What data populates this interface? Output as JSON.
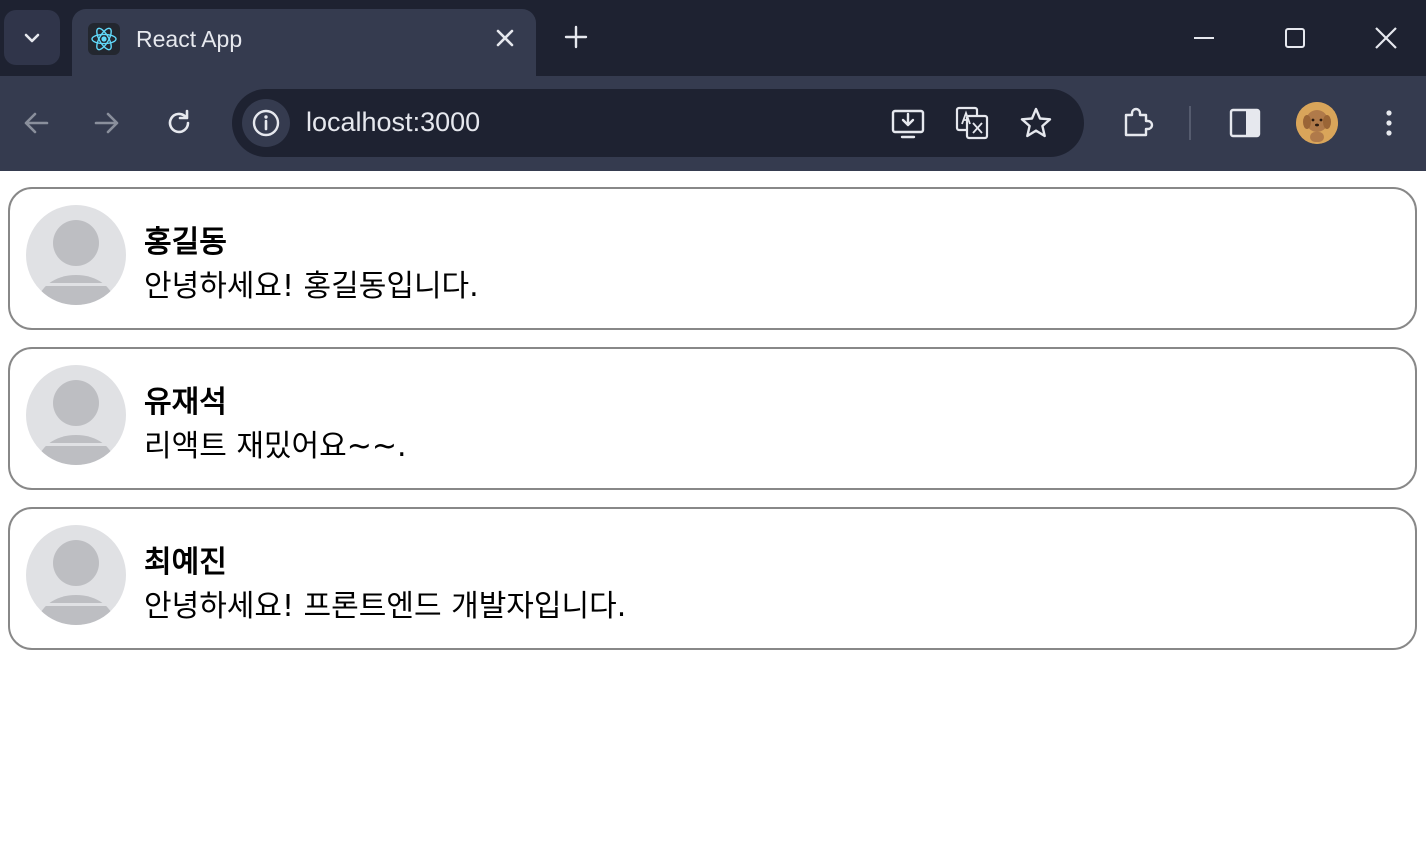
{
  "browser": {
    "tab": {
      "title": "React App",
      "favicon": "react-logo-icon"
    },
    "omnibox": {
      "url": "localhost:3000"
    },
    "icons": {
      "tab_search": "chevron-down-icon",
      "tab_close": "close-icon",
      "new_tab": "plus-icon",
      "back": "arrow-left-icon",
      "forward": "arrow-right-icon",
      "reload": "reload-icon",
      "site_info": "info-icon",
      "install": "install-app-icon",
      "translate": "translate-icon",
      "bookmark": "star-icon",
      "extensions": "puzzle-icon",
      "side_panel": "side-panel-icon",
      "profile": "profile-avatar",
      "menu": "kebab-menu-icon",
      "minimize": "minimize-icon",
      "maximize": "maximize-icon",
      "close_window": "close-icon"
    }
  },
  "comments": [
    {
      "name": "홍길동",
      "comment": "안녕하세요! 홍길동입니다."
    },
    {
      "name": "유재석",
      "comment": "리액트 재밌어요~~."
    },
    {
      "name": "최예진",
      "comment": "안녕하세요! 프론트엔드 개발자입니다."
    }
  ],
  "colors": {
    "chrome_dark": "#1e2231",
    "chrome_toolbar": "#353b4f",
    "card_border": "#888888",
    "avatar_bg": "#e0e1e4",
    "avatar_figure": "#bdbec2"
  }
}
